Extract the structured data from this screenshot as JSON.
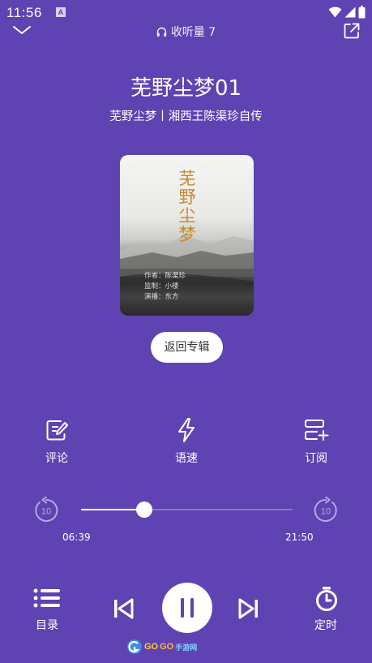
{
  "status_bar": {
    "time": "11:56",
    "app_badge": "A",
    "icons": [
      "wifi-icon",
      "signal-icon",
      "battery-icon"
    ]
  },
  "header": {
    "collapse_icon": "chevron-down-icon",
    "listen_icon": "headphones-icon",
    "listen_count": "收听量 7",
    "share_icon": "share-external-icon"
  },
  "track": {
    "title": "芜野尘梦01",
    "subtitle": "芜野尘梦丨湘西王陈渠珍自传"
  },
  "cover": {
    "title": "芜野尘梦",
    "credits": [
      "作者：陈渠珍",
      "监制：小楼",
      "演播：东方"
    ]
  },
  "back_to_album": "返回专辑",
  "actions": {
    "comment": "评论",
    "speed": "语速",
    "subscribe": "订阅"
  },
  "progress": {
    "current": "06:39",
    "total": "21:50",
    "percent": 0.3,
    "rewind_seconds": "10",
    "forward_seconds": "10"
  },
  "bottom_bar": {
    "catalog": "目录",
    "timer": "定时",
    "play_state": "playing"
  },
  "watermark": {
    "text_a": "GO",
    "text_b": "GO",
    "text_c": "手游网"
  },
  "colors": {
    "background": "#5f43b2",
    "track": "#8b77c8",
    "cover_title": "#c48a2e",
    "white": "#ffffff"
  }
}
